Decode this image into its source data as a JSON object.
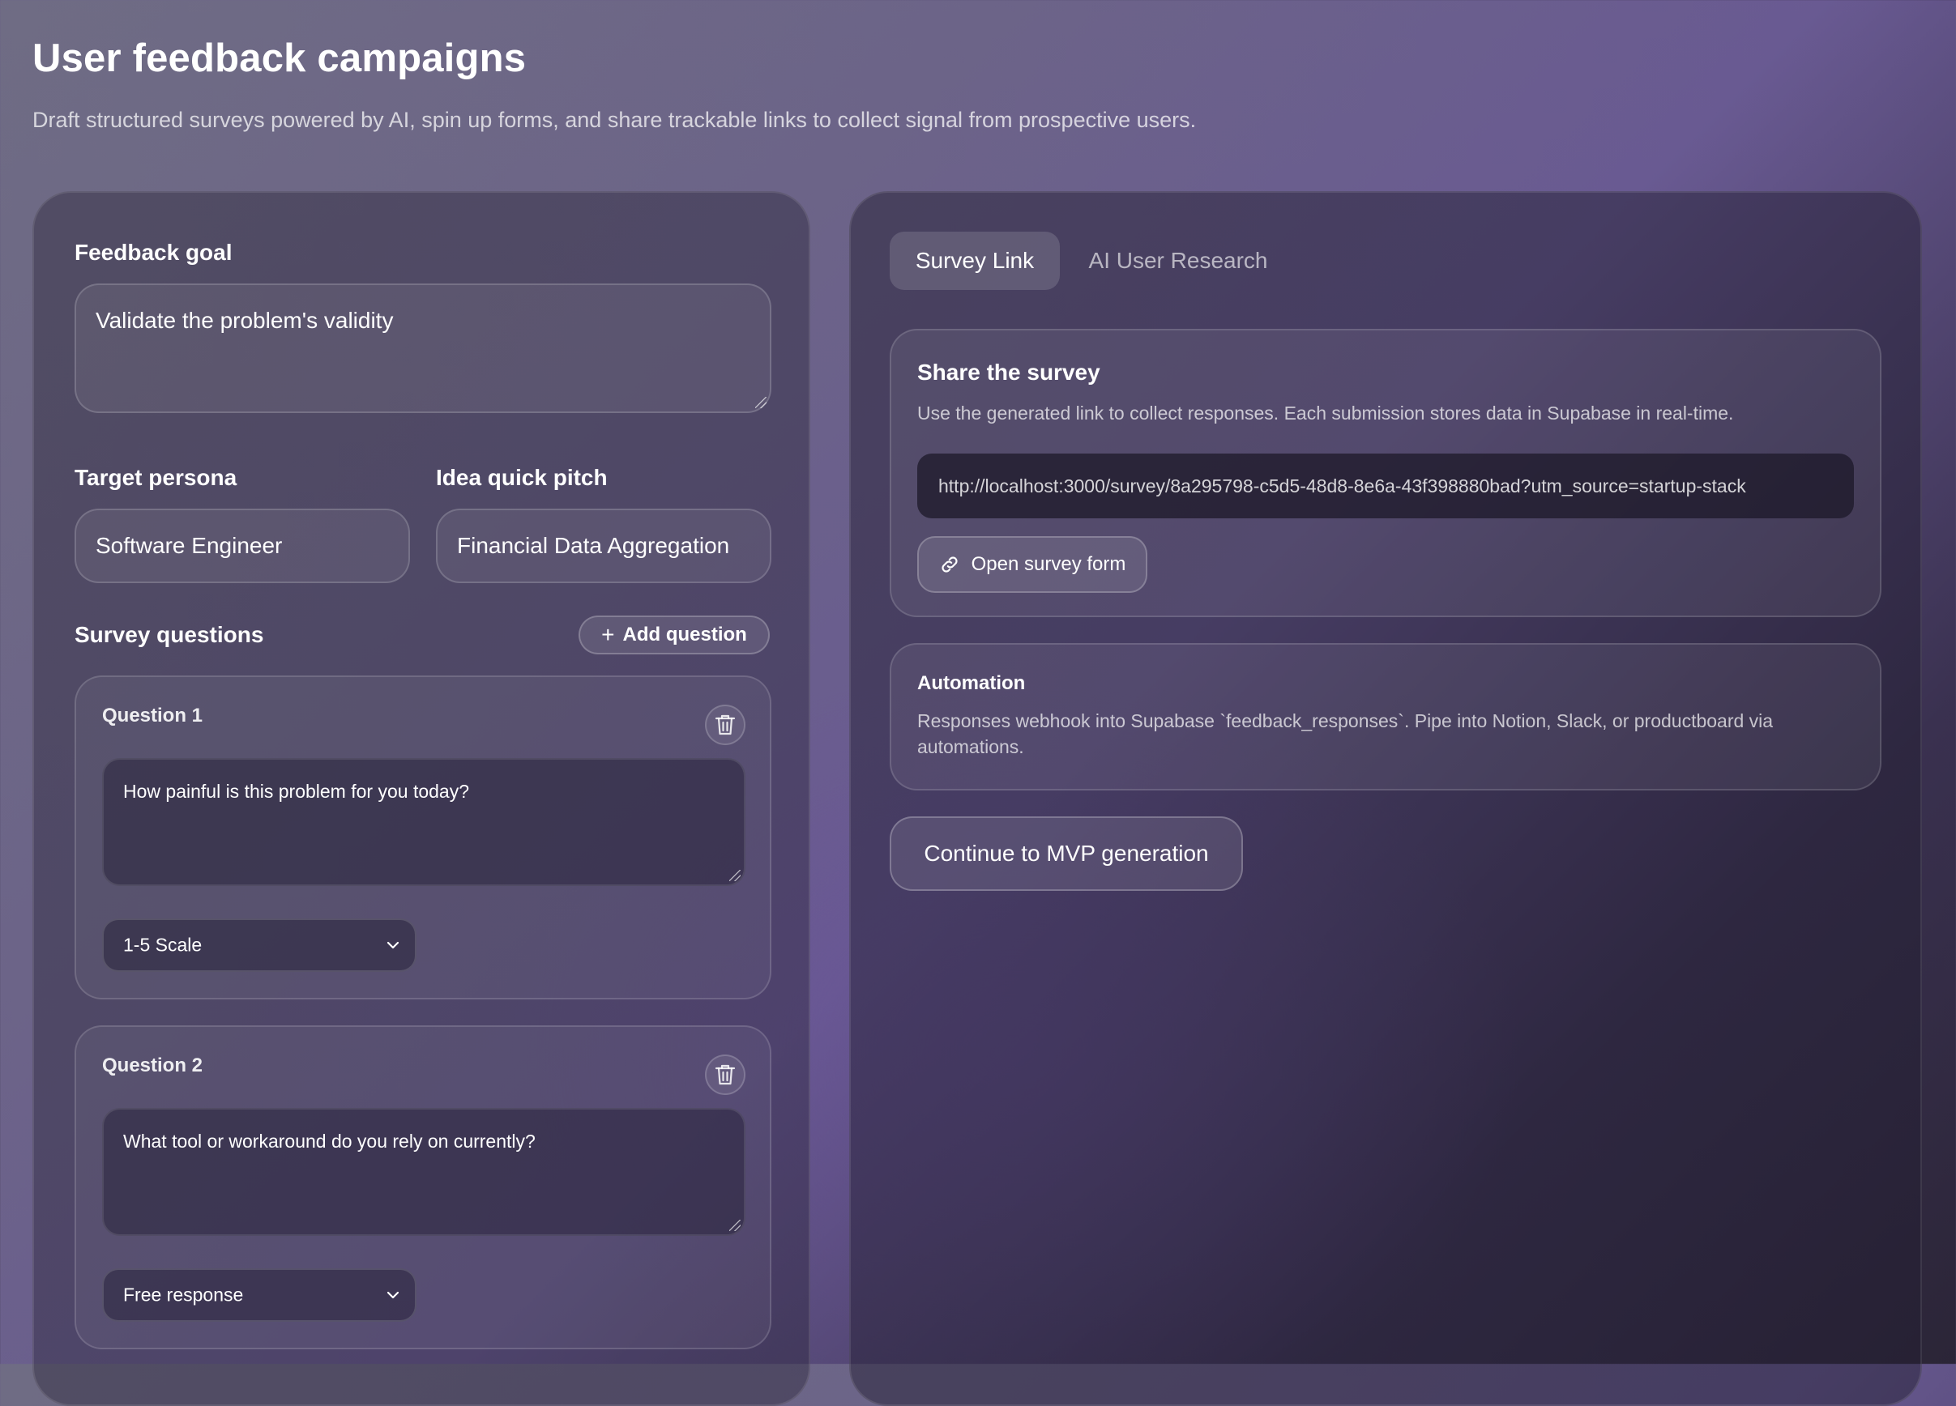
{
  "header": {
    "title": "User feedback campaigns",
    "subtitle": "Draft structured surveys powered by AI, spin up forms, and share trackable links to collect signal from prospective users."
  },
  "form": {
    "feedback_goal_label": "Feedback goal",
    "feedback_goal_value": "Validate the problem's validity",
    "target_persona_label": "Target persona",
    "target_persona_value": "Software Engineer",
    "idea_pitch_label": "Idea quick pitch",
    "idea_pitch_value": "Financial Data Aggregation",
    "survey_questions_label": "Survey questions",
    "add_question_label": "Add question",
    "questions": [
      {
        "label": "Question 1",
        "text": "How painful is this problem for you today?",
        "type": "1-5 Scale"
      },
      {
        "label": "Question 2",
        "text": "What tool or workaround do you rely on currently?",
        "type": "Free response"
      }
    ]
  },
  "tabs": [
    {
      "label": "Survey Link",
      "active": true
    },
    {
      "label": "AI User Research",
      "active": false
    }
  ],
  "share": {
    "title": "Share the survey",
    "description": "Use the generated link to collect responses. Each submission stores data in Supabase in real-time.",
    "url": "http://localhost:3000/survey/8a295798-c5d5-48d8-8e6a-43f398880bad?utm_source=startup-stack",
    "open_button_label": "Open survey form"
  },
  "automation": {
    "title": "Automation",
    "description": "Responses webhook into Supabase `feedback_responses`. Pipe into Notion, Slack, or productboard via automations."
  },
  "continue_button_label": "Continue to MVP generation",
  "icons": {
    "add": "plus-icon",
    "delete": "trash-icon",
    "dropdown": "chevron-down-icon",
    "link": "link-icon"
  }
}
